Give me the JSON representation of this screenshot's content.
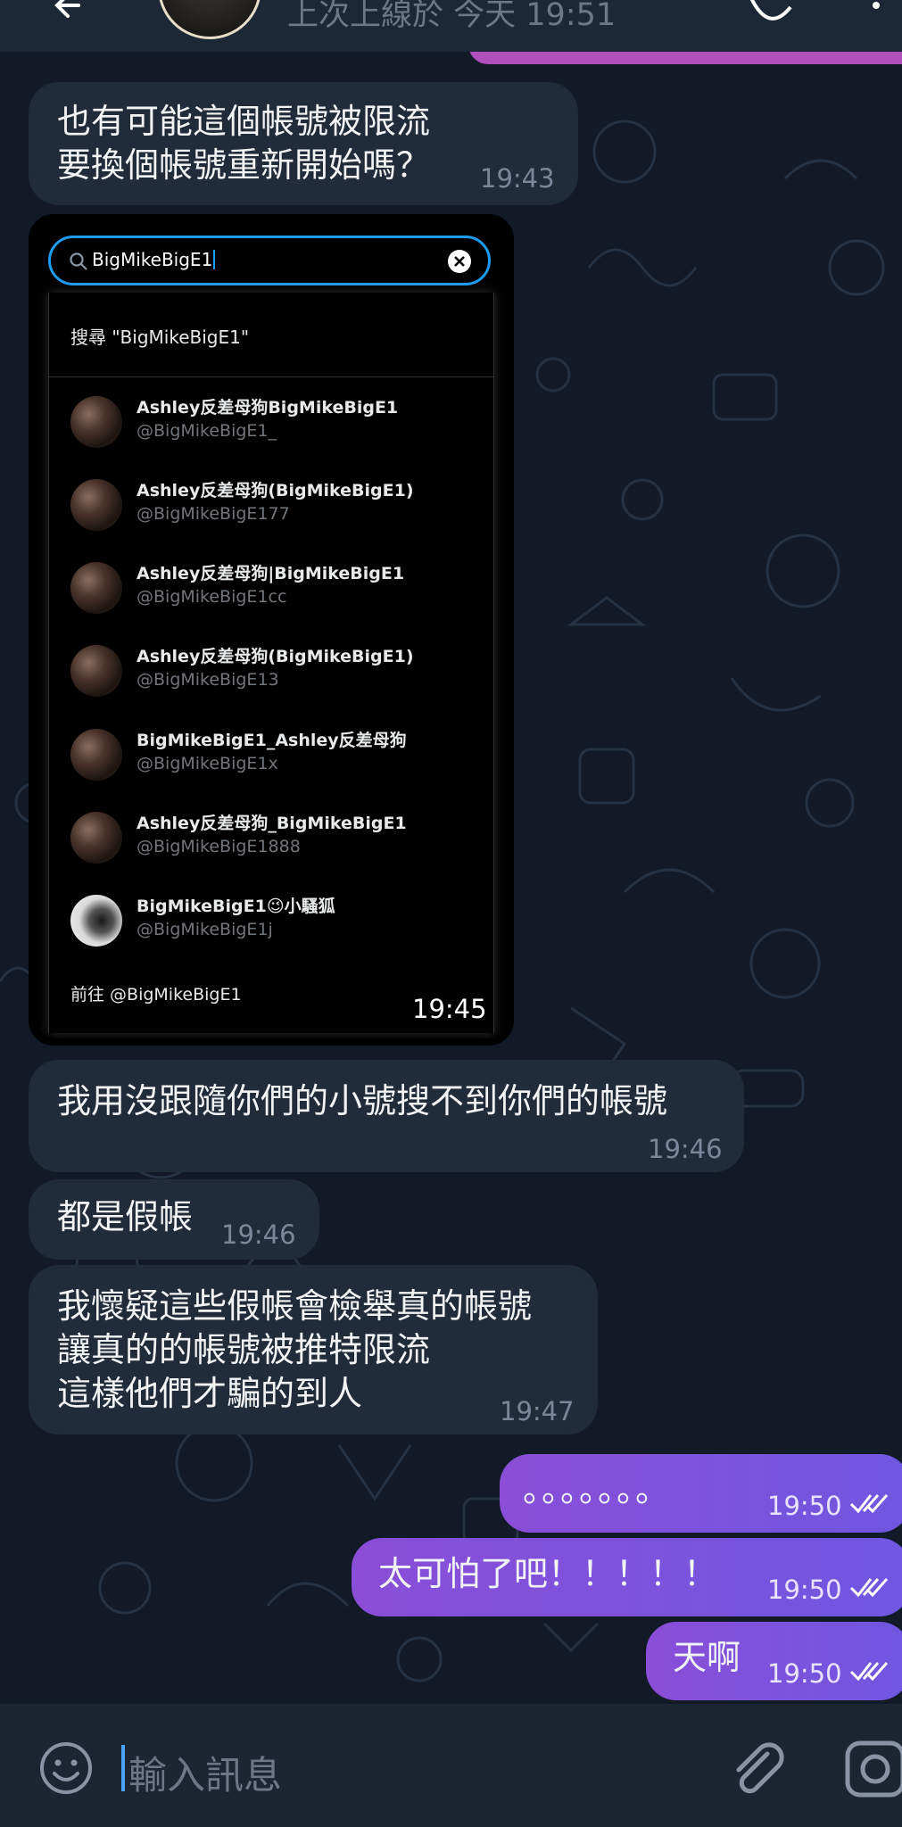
{
  "header": {
    "last_seen": "上次上線於 今天 19:51"
  },
  "messages": [
    {
      "id": "m1",
      "direction": "in",
      "text": "也有可能這個帳號被限流\n要換個帳號重新開始嗎？",
      "time": "19:43"
    },
    {
      "id": "m3",
      "direction": "in",
      "text": "我用沒跟隨你們的小號搜不到你們的帳號",
      "time": "19:46"
    },
    {
      "id": "m4",
      "direction": "in",
      "text": "都是假帳",
      "time": "19:46"
    },
    {
      "id": "m5",
      "direction": "in",
      "text": "我懷疑這些假帳會檢舉真的帳號\n讓真的的帳號被推特限流\n這樣他們才騙的到人",
      "time": "19:47"
    },
    {
      "id": "m6",
      "direction": "out",
      "text": "。。。。。。。",
      "time": "19:50"
    },
    {
      "id": "m7",
      "direction": "out",
      "text": "太可怕了吧！！！！！",
      "time": "19:50"
    },
    {
      "id": "m8",
      "direction": "out",
      "text": "天啊",
      "time": "19:50"
    }
  ],
  "screenshot": {
    "time": "19:45",
    "search_text": "BigMikeBigE1",
    "search_query_label": "搜尋 \"BigMikeBigE1\"",
    "results": [
      {
        "name": "Ashley反差母狗BigMikeBigE1",
        "handle": "@BigMikeBigE1_"
      },
      {
        "name": "Ashley反差母狗(BigMikeBigE1)",
        "handle": "@BigMikeBigE177"
      },
      {
        "name": "Ashley反差母狗|BigMikeBigE1",
        "handle": "@BigMikeBigE1cc"
      },
      {
        "name": "Ashley反差母狗(BigMikeBigE1)",
        "handle": "@BigMikeBigE13"
      },
      {
        "name": "BigMikeBigE1_Ashley反差母狗",
        "handle": "@BigMikeBigE1x"
      },
      {
        "name": "Ashley反差母狗_BigMikeBigE1",
        "handle": "@BigMikeBigE1888"
      },
      {
        "name": "BigMikeBigE1😉小騷狐",
        "handle": "@BigMikeBigE1j"
      }
    ],
    "goto_label": "前往 @BigMikeBigE1"
  },
  "input": {
    "placeholder": "輸入訊息"
  },
  "colors": {
    "background": "#111a26",
    "incoming_bubble": "#212c3a",
    "outgoing_bubble_start": "#8a4ed8",
    "outgoing_bubble_end": "#6f57e0",
    "search_border": "#1d9bf0"
  }
}
